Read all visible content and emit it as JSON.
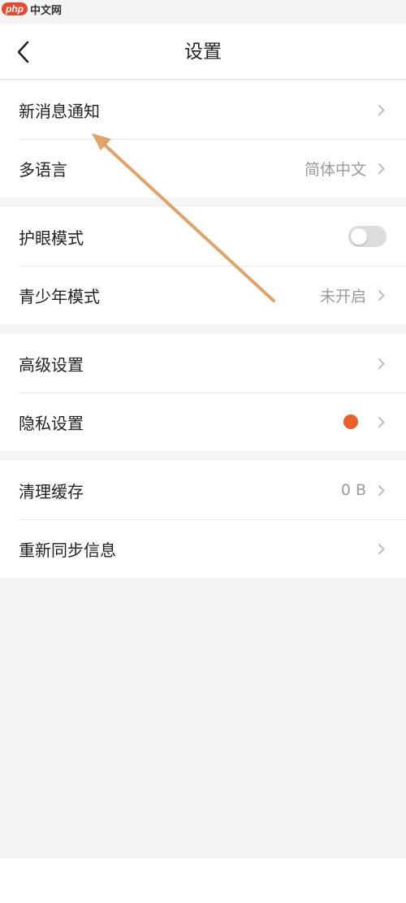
{
  "watermark": {
    "logo": "php",
    "text": "中文网"
  },
  "header": {
    "title": "设置"
  },
  "groups": [
    {
      "rows": [
        {
          "label": "新消息通知",
          "value": ""
        },
        {
          "label": "多语言",
          "value": "简体中文"
        }
      ]
    },
    {
      "rows": [
        {
          "label": "护眼模式",
          "toggle": false
        },
        {
          "label": "青少年模式",
          "value": "未开启"
        }
      ]
    },
    {
      "rows": [
        {
          "label": "高级设置",
          "value": ""
        },
        {
          "label": "隐私设置",
          "badge": "dot"
        }
      ]
    },
    {
      "rows": [
        {
          "label": "清理缓存",
          "value": "0 B"
        },
        {
          "label": "重新同步信息",
          "value": ""
        }
      ]
    }
  ],
  "colors": {
    "accent_dot": "#e8602c",
    "annotation_arrow": "#e0a36a",
    "toggle_off": "#dcdcdc",
    "background": "#f4f4f4"
  },
  "icons": {
    "back": "chevron-left-icon",
    "row_arrow": "chevron-right-icon"
  }
}
